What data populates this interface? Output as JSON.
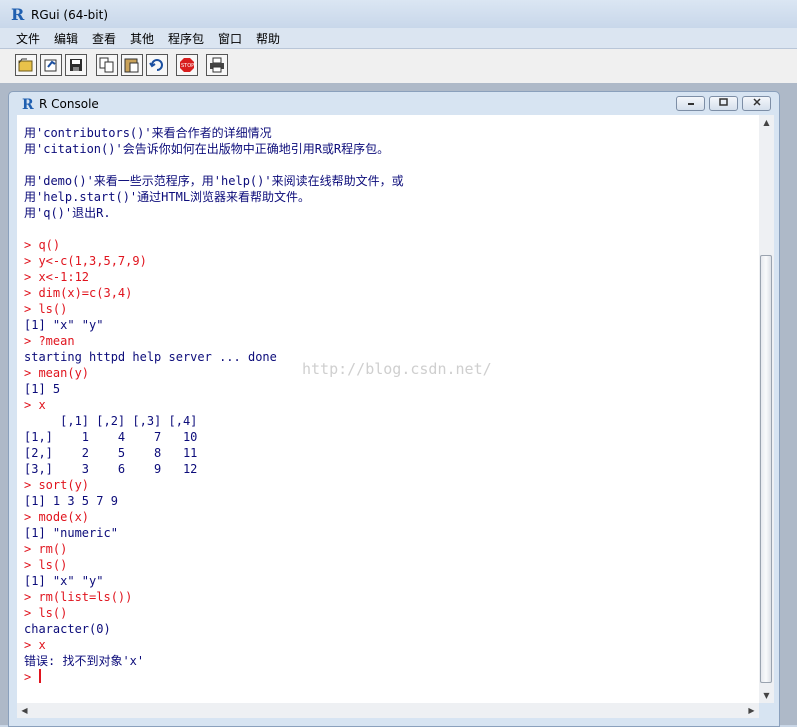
{
  "app": {
    "title": "RGui (64-bit)"
  },
  "menu": [
    "文件",
    "编辑",
    "查看",
    "其他",
    "程序包",
    "窗口",
    "帮助"
  ],
  "toolbar": [
    "open-script",
    "load-workspace",
    "save-workspace",
    "copy",
    "paste",
    "copy-and-paste",
    "stop",
    "print"
  ],
  "console_window": {
    "title": "R Console",
    "buttons": [
      "minimize",
      "restore",
      "close"
    ]
  },
  "console_lines": [
    {
      "type": "text",
      "text": "用'contributors()'来看合作者的详细情况"
    },
    {
      "type": "text",
      "text": "用'citation()'会告诉你如何在出版物中正确地引用R或R程序包。"
    },
    {
      "type": "blank",
      "text": ""
    },
    {
      "type": "text",
      "text": "用'demo()'来看一些示范程序，用'help()'来阅读在线帮助文件，或"
    },
    {
      "type": "text",
      "text": "用'help.start()'通过HTML浏览器来看帮助文件。"
    },
    {
      "type": "text",
      "text": "用'q()'退出R."
    },
    {
      "type": "blank",
      "text": ""
    },
    {
      "type": "input",
      "text": "> q()"
    },
    {
      "type": "input",
      "text": "> y<-c(1,3,5,7,9)"
    },
    {
      "type": "input",
      "text": "> x<-1:12"
    },
    {
      "type": "input",
      "text": "> dim(x)=c(3,4)"
    },
    {
      "type": "input",
      "text": "> ls()"
    },
    {
      "type": "output",
      "text": "[1] \"x\" \"y\""
    },
    {
      "type": "input",
      "text": "> ?mean"
    },
    {
      "type": "output",
      "text": "starting httpd help server ... done"
    },
    {
      "type": "input",
      "text": "> mean(y)"
    },
    {
      "type": "output",
      "text": "[1] 5"
    },
    {
      "type": "input",
      "text": "> x"
    },
    {
      "type": "output",
      "text": "     [,1] [,2] [,3] [,4]"
    },
    {
      "type": "output",
      "text": "[1,]    1    4    7   10"
    },
    {
      "type": "output",
      "text": "[2,]    2    5    8   11"
    },
    {
      "type": "output",
      "text": "[3,]    3    6    9   12"
    },
    {
      "type": "input",
      "text": "> sort(y)"
    },
    {
      "type": "output",
      "text": "[1] 1 3 5 7 9"
    },
    {
      "type": "input",
      "text": "> mode(x)"
    },
    {
      "type": "output",
      "text": "[1] \"numeric\""
    },
    {
      "type": "input",
      "text": "> rm()"
    },
    {
      "type": "input",
      "text": "> ls()"
    },
    {
      "type": "output",
      "text": "[1] \"x\" \"y\""
    },
    {
      "type": "input",
      "text": "> rm(list=ls())"
    },
    {
      "type": "input",
      "text": "> ls()"
    },
    {
      "type": "output",
      "text": "character(0)"
    },
    {
      "type": "input",
      "text": "> x"
    },
    {
      "type": "output",
      "text": "错误: 找不到对象'x'"
    },
    {
      "type": "prompt",
      "text": "> "
    }
  ],
  "watermark": "http://blog.csdn.net/",
  "colors": {
    "input": "#e0141e",
    "output": "#0c0c7a"
  }
}
